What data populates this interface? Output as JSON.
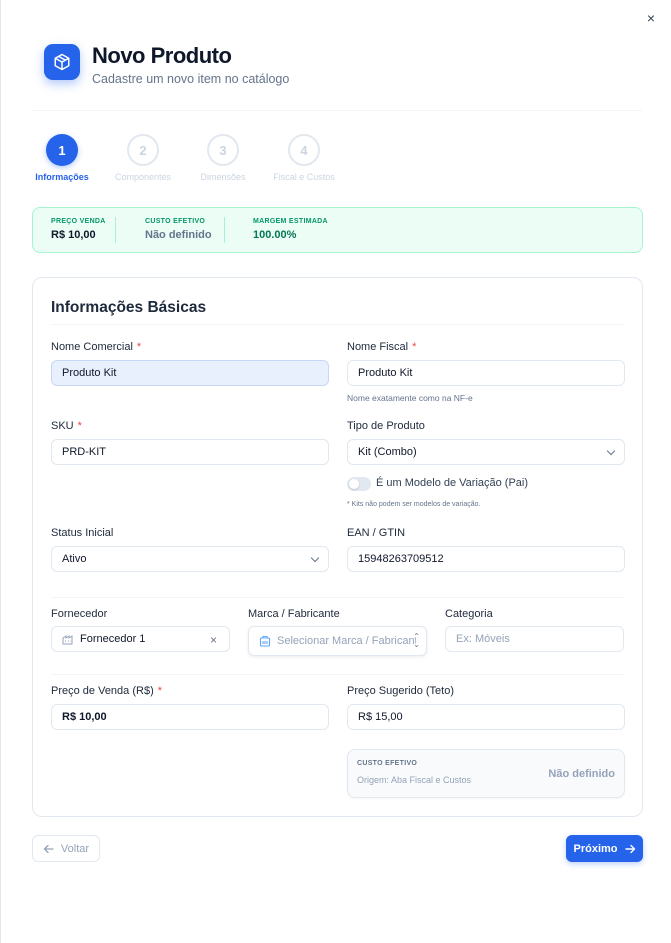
{
  "close_label": "×",
  "header": {
    "title": "Novo Produto",
    "subtitle": "Cadastre um novo item no catálogo",
    "icon": "box-icon"
  },
  "steps": [
    {
      "num": "1",
      "label": "Informações",
      "state": "active"
    },
    {
      "num": "2",
      "label": "Componentes",
      "state": "todo"
    },
    {
      "num": "3",
      "label": "Dimensões",
      "state": "todo"
    },
    {
      "num": "4",
      "label": "Fiscal e Custos",
      "state": "todo"
    }
  ],
  "summary": {
    "price": {
      "label": "PREÇO VENDA",
      "value": "R$ 10,00"
    },
    "cost": {
      "label": "CUSTO EFETIVO",
      "value": "Não definido"
    },
    "margin": {
      "label": "MARGEM ESTIMADA",
      "value": "100.00%"
    }
  },
  "card": {
    "title": "Informações Básicas",
    "nome_comercial": {
      "label": "Nome Comercial",
      "required": "*",
      "value": "Produto Kit"
    },
    "nome_fiscal": {
      "label": "Nome Fiscal",
      "required": "*",
      "value": "Produto Kit",
      "hint": "Nome exatamente como na NF-e"
    },
    "sku": {
      "label": "SKU",
      "required": "*",
      "value": "PRD-KIT"
    },
    "tipo_produto": {
      "label": "Tipo de Produto",
      "value": "Kit (Combo)"
    },
    "variacao": {
      "label": "É um Modelo de Variação (Pai)",
      "note": "* Kits não podem ser modelos de variação.",
      "on": false
    },
    "status": {
      "label": "Status Inicial",
      "value": "Ativo"
    },
    "ean": {
      "label": "EAN / GTIN",
      "value": "15948263709512"
    },
    "fornecedor": {
      "label": "Fornecedor",
      "value": "Fornecedor 1",
      "clear": "×"
    },
    "marca": {
      "label": "Marca / Fabricante",
      "placeholder": "Selecionar Marca / Fabricante"
    },
    "categoria": {
      "label": "Categoria",
      "placeholder": "Ex: Móveis"
    },
    "preco_venda": {
      "label": "Preço de Venda (R$)",
      "required": "*",
      "value": "R$ 10,00"
    },
    "preco_sugerido": {
      "label": "Preço Sugerido (Teto)",
      "value": "R$ 15,00"
    },
    "custo_efetivo": {
      "label": "CUSTO EFETIVO",
      "origin": "Origem: Aba Fiscal e Custos",
      "value": "Não definido"
    }
  },
  "footer": {
    "back_label": "Voltar",
    "next_label": "Próximo"
  },
  "colors": {
    "accent": "#2563eb",
    "success_bg": "#ecfdf5",
    "required": "#ef4444"
  }
}
